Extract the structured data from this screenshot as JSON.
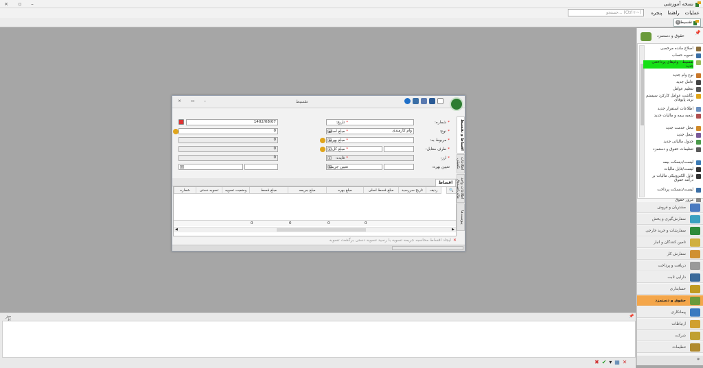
{
  "app": {
    "title": "نسخه آموزشی",
    "window_buttons": [
      "×",
      "▫",
      "–"
    ]
  },
  "menu": {
    "items": [
      "عملیات",
      "راهنما",
      "پنجره"
    ],
    "search_placeholder": "جستجو... (Ctrl+~)"
  },
  "doc_tab": {
    "label": "تقسیط"
  },
  "right_panel": {
    "header": "حقوق و دستمزد",
    "items": [
      {
        "label": "اصلاح مانده مرخصی",
        "icon_color": "#8a6d3b",
        "highlight": false
      },
      {
        "label": "تسویه حساب",
        "icon_color": "#3a6ea5",
        "highlight": false
      },
      {
        "label": "تقسیط - وام‌های پرداختنی جدید",
        "icon_color": "#9bbb59",
        "highlight": true
      },
      {
        "label": "نوع وام جدید",
        "icon_color": "#c9772a",
        "highlight": false
      },
      {
        "label": "عامل جدید",
        "icon_color": "#444444",
        "highlight": false
      },
      {
        "label": "تنظیم عوامل",
        "icon_color": "#555555",
        "highlight": false
      },
      {
        "label": "نگاشت عوامل کارکرد سیستم تردد پایوفای",
        "icon_color": "#e0a51c",
        "highlight": false
      },
      {
        "label": "اطلاعات استقرار جدید",
        "icon_color": "#6a8fbf",
        "highlight": false
      },
      {
        "label": "شعبه بیمه و مالیات جدید",
        "icon_color": "#b05050",
        "highlight": false
      },
      {
        "label": "محل خدمت جدید",
        "icon_color": "#d08a2a",
        "highlight": false
      },
      {
        "label": "شغل جدید",
        "icon_color": "#7a5a9a",
        "highlight": false
      },
      {
        "label": "جدول مالیاتی جدید",
        "icon_color": "#4a9a4a",
        "highlight": false
      },
      {
        "label": "تنظیمات حقوق و دستمزد",
        "icon_color": "#5a5a5a",
        "highlight": false
      },
      {
        "label": "لیست/دیسکت بیمه",
        "icon_color": "#3a7ab5",
        "highlight": false
      },
      {
        "label": "لیست/فایل مالیات",
        "icon_color": "#333333",
        "highlight": false
      },
      {
        "label": "فایل الکترونیکی مالیات بر درآمد حقوق",
        "icon_color": "#333333",
        "highlight": false
      },
      {
        "label": "لیست/دیسکت پرداخت",
        "icon_color": "#3a6ea5",
        "highlight": false
      },
      {
        "label": "مرور حقوق",
        "icon_color": "#8a8a8a",
        "highlight": false
      }
    ],
    "nav": [
      {
        "label": "مشتریان و فروش",
        "icon_color": "#4a7ac0",
        "active": false
      },
      {
        "label": "سفارش‌گیری و پخش",
        "icon_color": "#3aa0c0",
        "active": false
      },
      {
        "label": "سفارشات و خرید خارجی",
        "icon_color": "#2e8b3a",
        "active": false
      },
      {
        "label": "تامین کنندگان و انبار",
        "icon_color": "#d0b040",
        "active": false
      },
      {
        "label": "سفارش کار",
        "icon_color": "#d09030",
        "active": false
      },
      {
        "label": "دریافت و پرداخت",
        "icon_color": "#9a9a9a",
        "active": false
      },
      {
        "label": "دارایی ثابت",
        "icon_color": "#3a6a9a",
        "active": false
      },
      {
        "label": "حسابداری",
        "icon_color": "#c09a20",
        "active": false
      },
      {
        "label": "حقوق و دستمزد",
        "icon_color": "#6a9a3a",
        "active": true
      },
      {
        "label": "پیمانکاری",
        "icon_color": "#3a7ac0",
        "active": false
      },
      {
        "label": "ارتباطات",
        "icon_color": "#d0a030",
        "active": false
      },
      {
        "label": "شرکت",
        "icon_color": "#c0a030",
        "active": false
      },
      {
        "label": "تنظیمات",
        "icon_color": "#b08a30",
        "active": false
      }
    ]
  },
  "bottom_panel": {
    "title": "میز کار",
    "actions": [
      "✖",
      "✔",
      "▾",
      "▦",
      "✕"
    ]
  },
  "dialog": {
    "title": "تقسیط",
    "window_buttons": [
      "×",
      "▭",
      "–"
    ],
    "vertical_tabs": [
      "اقساط و تقسیط",
      "اطلاعات تکمیلی",
      "اطلاعات واحد مالی/صندوق",
      "پیوست‌ها"
    ],
    "fields": {
      "number_label": "شماره:",
      "date_label": "تاریخ:",
      "date_value": "1402/08/07",
      "type_label": "نوع:",
      "type_value": "وام کارمندی",
      "principal_label": "مبلغ اصلی:",
      "principal_value": "0",
      "related_label": "مربوط به:",
      "interest_label": "مبلغ بهره:",
      "interest_value": "0",
      "counterparty_label": "طرف مقابل:",
      "total_label": "مبلغ کل:",
      "total_value": "0",
      "currency_label": "ارز:",
      "rate_label": "فایده:",
      "rate_value": "0",
      "fine_label": "تعیین جریمه:",
      "assign_label": "تعیین بهره:"
    },
    "grid_tab": "اقساط",
    "columns": [
      "ردیف",
      "تاریخ سررسید",
      "مبلغ قسط اصلی",
      "مبلغ بهره",
      "مبلغ جریمه",
      "مبلغ قسط",
      "وضعیت تسویه",
      "تسویه دستی",
      "شماره"
    ],
    "footer_values": [
      "",
      "",
      "0",
      "0",
      "0",
      "0",
      "",
      "",
      ""
    ],
    "grid_nav": "ایجاد اقساط  محاسبه جریمه  تسویه با رسید  تسویه دستی  برگشت تسویه"
  },
  "colors": {
    "workspace": "#a6a6a6",
    "active_nav": "#f4a64a",
    "highlight": "#16e016",
    "required": "#e11111"
  }
}
